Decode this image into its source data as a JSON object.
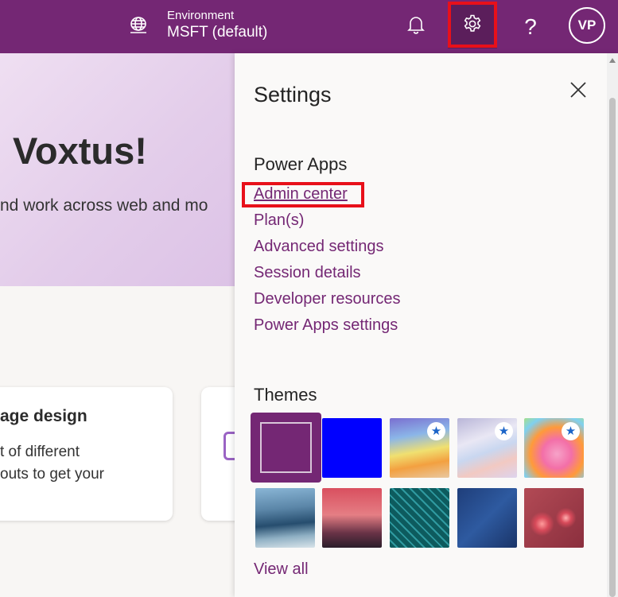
{
  "topbar": {
    "environment_label": "Environment",
    "environment_value": "MSFT (default)",
    "help_label": "?",
    "avatar_initials": "VP",
    "background_color": "#742774"
  },
  "background": {
    "hero_title": "Voxtus!",
    "hero_subtitle": "nd work across web and mo",
    "card1_title": "age design",
    "card1_description": "t of different\nouts to get your"
  },
  "settings": {
    "title": "Settings",
    "power_apps_heading": "Power Apps",
    "links": [
      "Admin center",
      "Plan(s)",
      "Advanced settings",
      "Session details",
      "Developer resources",
      "Power Apps settings"
    ],
    "themes_heading": "Themes",
    "view_all_label": "View all"
  },
  "themes": [
    {
      "name": "purple-theme",
      "selected": true,
      "premium": false
    },
    {
      "name": "blue-theme",
      "selected": false,
      "premium": false
    },
    {
      "name": "rainbow-theme",
      "selected": false,
      "premium": true
    },
    {
      "name": "silver-wave-theme",
      "selected": false,
      "premium": true
    },
    {
      "name": "unicorn-theme",
      "selected": false,
      "premium": true
    },
    {
      "name": "hills-theme",
      "selected": false,
      "premium": false
    },
    {
      "name": "palm-sunset-theme",
      "selected": false,
      "premium": false
    },
    {
      "name": "circuit-theme",
      "selected": false,
      "premium": false
    },
    {
      "name": "blueprint-theme",
      "selected": false,
      "premium": false
    },
    {
      "name": "bokeh-theme",
      "selected": false,
      "premium": false
    }
  ],
  "colors": {
    "accent": "#742774",
    "highlight": "#e8101a",
    "premium_star": "#1b64c8"
  }
}
